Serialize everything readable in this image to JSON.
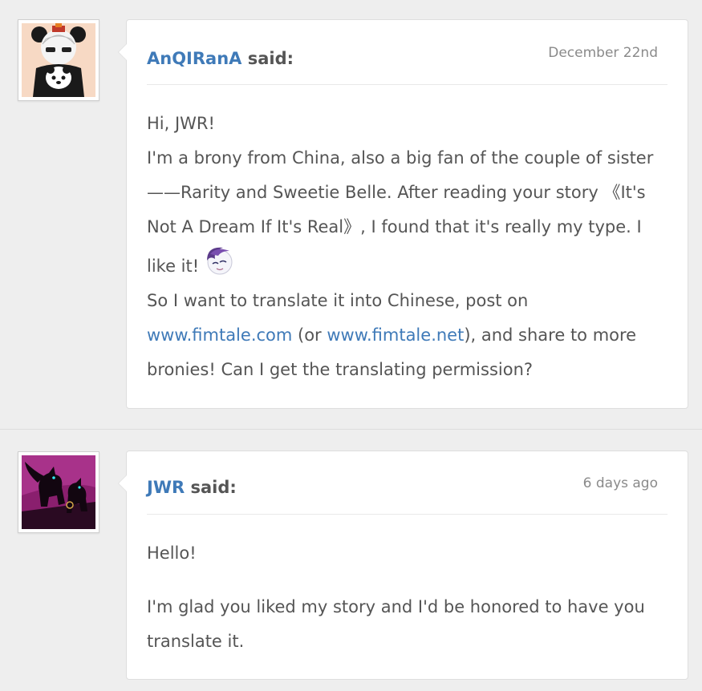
{
  "comments": [
    {
      "author": "AnQIRanA",
      "said": " said:",
      "timestamp": "December 22nd",
      "lines": {
        "l1": "Hi, JWR!",
        "l2": "I'm a brony from China, also a big fan of the couple of sister——Rarity and Sweetie Belle. After reading your story 《It's Not A Dream If It's Real》, I found that it's really my type. I like it!",
        "l3a": "So I want to translate it into Chinese, post on ",
        "link1": "www.fimtale.com",
        "l3b": " (or ",
        "link2": "www.fimtale.net",
        "l3c": "), and share to more bronies! Can I get the translating permission?"
      },
      "emote_icon": "rarity-emote-icon"
    },
    {
      "author": "JWR",
      "said": " said:",
      "timestamp": "6 days ago",
      "lines": {
        "p1": "Hello!",
        "p2": "I'm glad you liked my story and I'd be honored to have you translate it."
      }
    }
  ],
  "colors": {
    "link": "#3f7ab8",
    "text": "#555555",
    "background": "#eeeeee"
  }
}
